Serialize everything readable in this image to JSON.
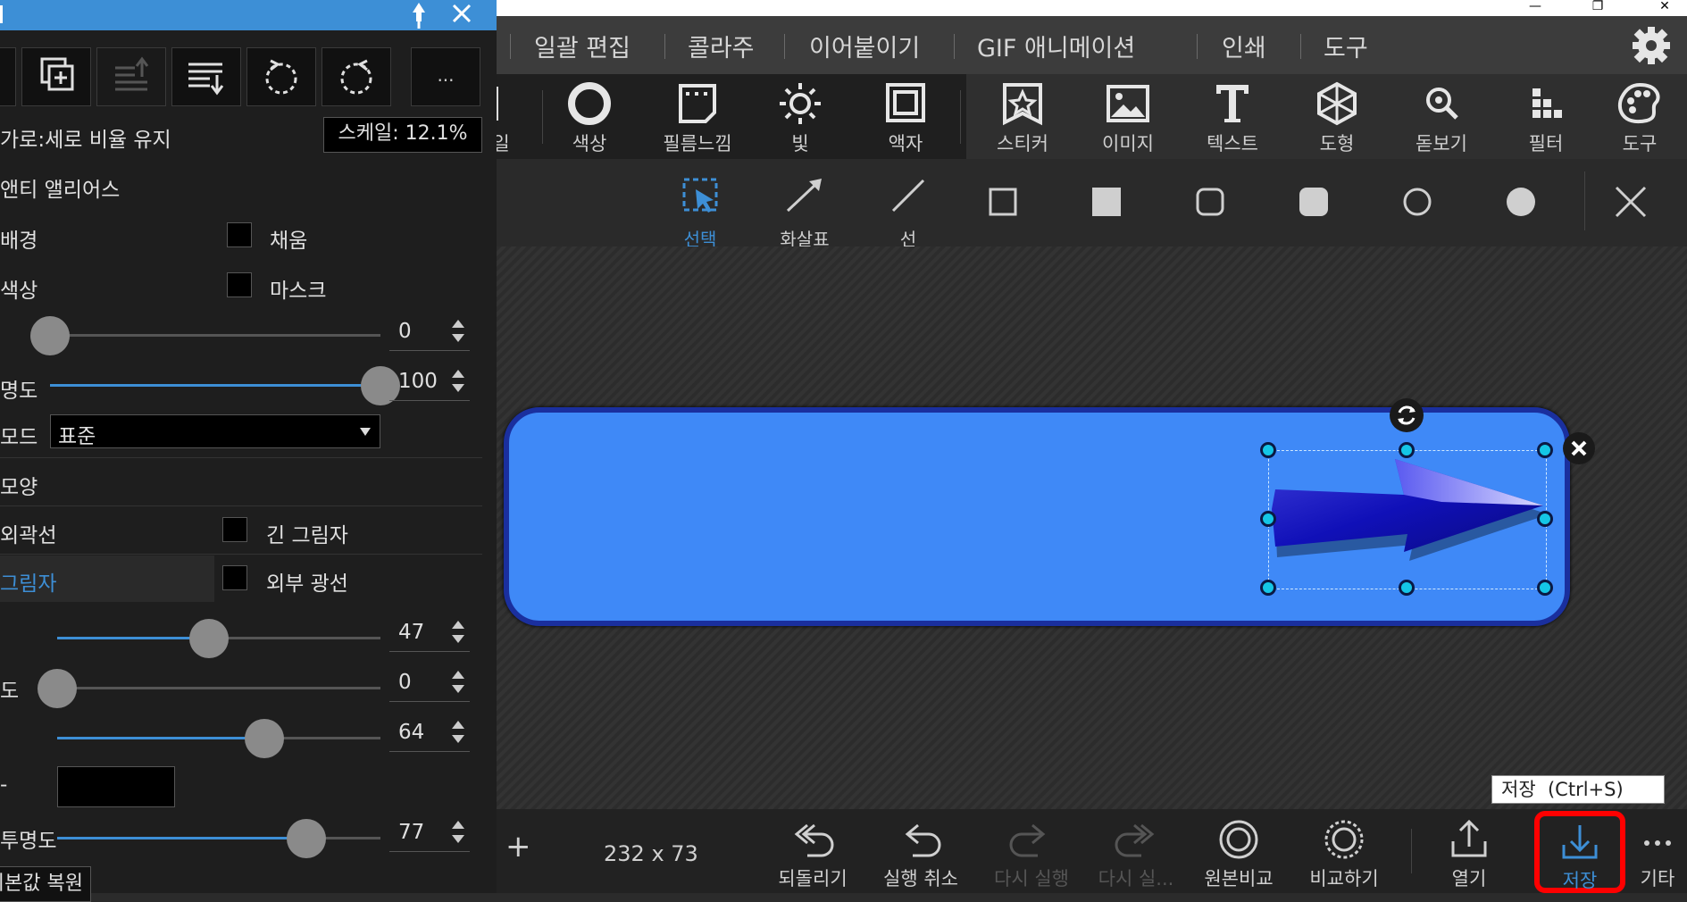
{
  "window": {
    "minimize_glyph": "—",
    "maximize_glyph": "❐",
    "close_glyph": "✕"
  },
  "menu": {
    "items": [
      "일괄 편집",
      "콜라주",
      "이어붙이기",
      "GIF 애니메이션",
      "인쇄",
      "도구"
    ]
  },
  "ribbon": {
    "tools": [
      "색상",
      "필름느낌",
      "빛",
      "액자",
      "스티커",
      "이미지",
      "텍스트",
      "도형",
      "돋보기",
      "필터",
      "도구"
    ],
    "partial_label": "일"
  },
  "shapebar": {
    "tools": [
      "선택",
      "화살표",
      "선"
    ]
  },
  "canvas": {
    "dimensions": "232 x 73"
  },
  "tooltip": {
    "text": "저장  (Ctrl+S)"
  },
  "bottom": {
    "add": "+",
    "buttons": [
      "되돌리기",
      "실행 취소",
      "다시 실행",
      "다시 실...",
      "원본비교",
      "비교하기",
      "열기",
      "저장",
      "기타"
    ]
  },
  "panel": {
    "more_button": "...",
    "keep_ratio": "가로:세로 비율 유지",
    "scale_label": "스케일: 12.1%",
    "antialias": "앤티 앨리어스",
    "background": "배경",
    "fill": "채움",
    "color": "색상",
    "mask": "마스크",
    "slider1_value": "0",
    "opacity_label": "명도",
    "slider2_value": "100",
    "mode_label": "모드",
    "mode_value": "표준",
    "shape_label": "모양",
    "outline": "외곽선",
    "long_shadow": "긴 그림자",
    "shadow": "그림자",
    "outer_glow": "외부 광선",
    "s3_value": "47",
    "s4_label": "도",
    "s4_value": "0",
    "s5_value": "64",
    "s6_label": "-",
    "s7_label": "투명도",
    "s7_value": "77",
    "reset": "기본값 복원"
  },
  "levels": {
    "slider1": 0.0,
    "slider2": 1.0,
    "s3": 0.47,
    "s4": 0.0,
    "s5": 0.64,
    "s7": 0.77
  },
  "colors": {
    "accent": "#3d8fd6",
    "banner": "#3f89f7",
    "save_highlight": "#ff0000"
  }
}
